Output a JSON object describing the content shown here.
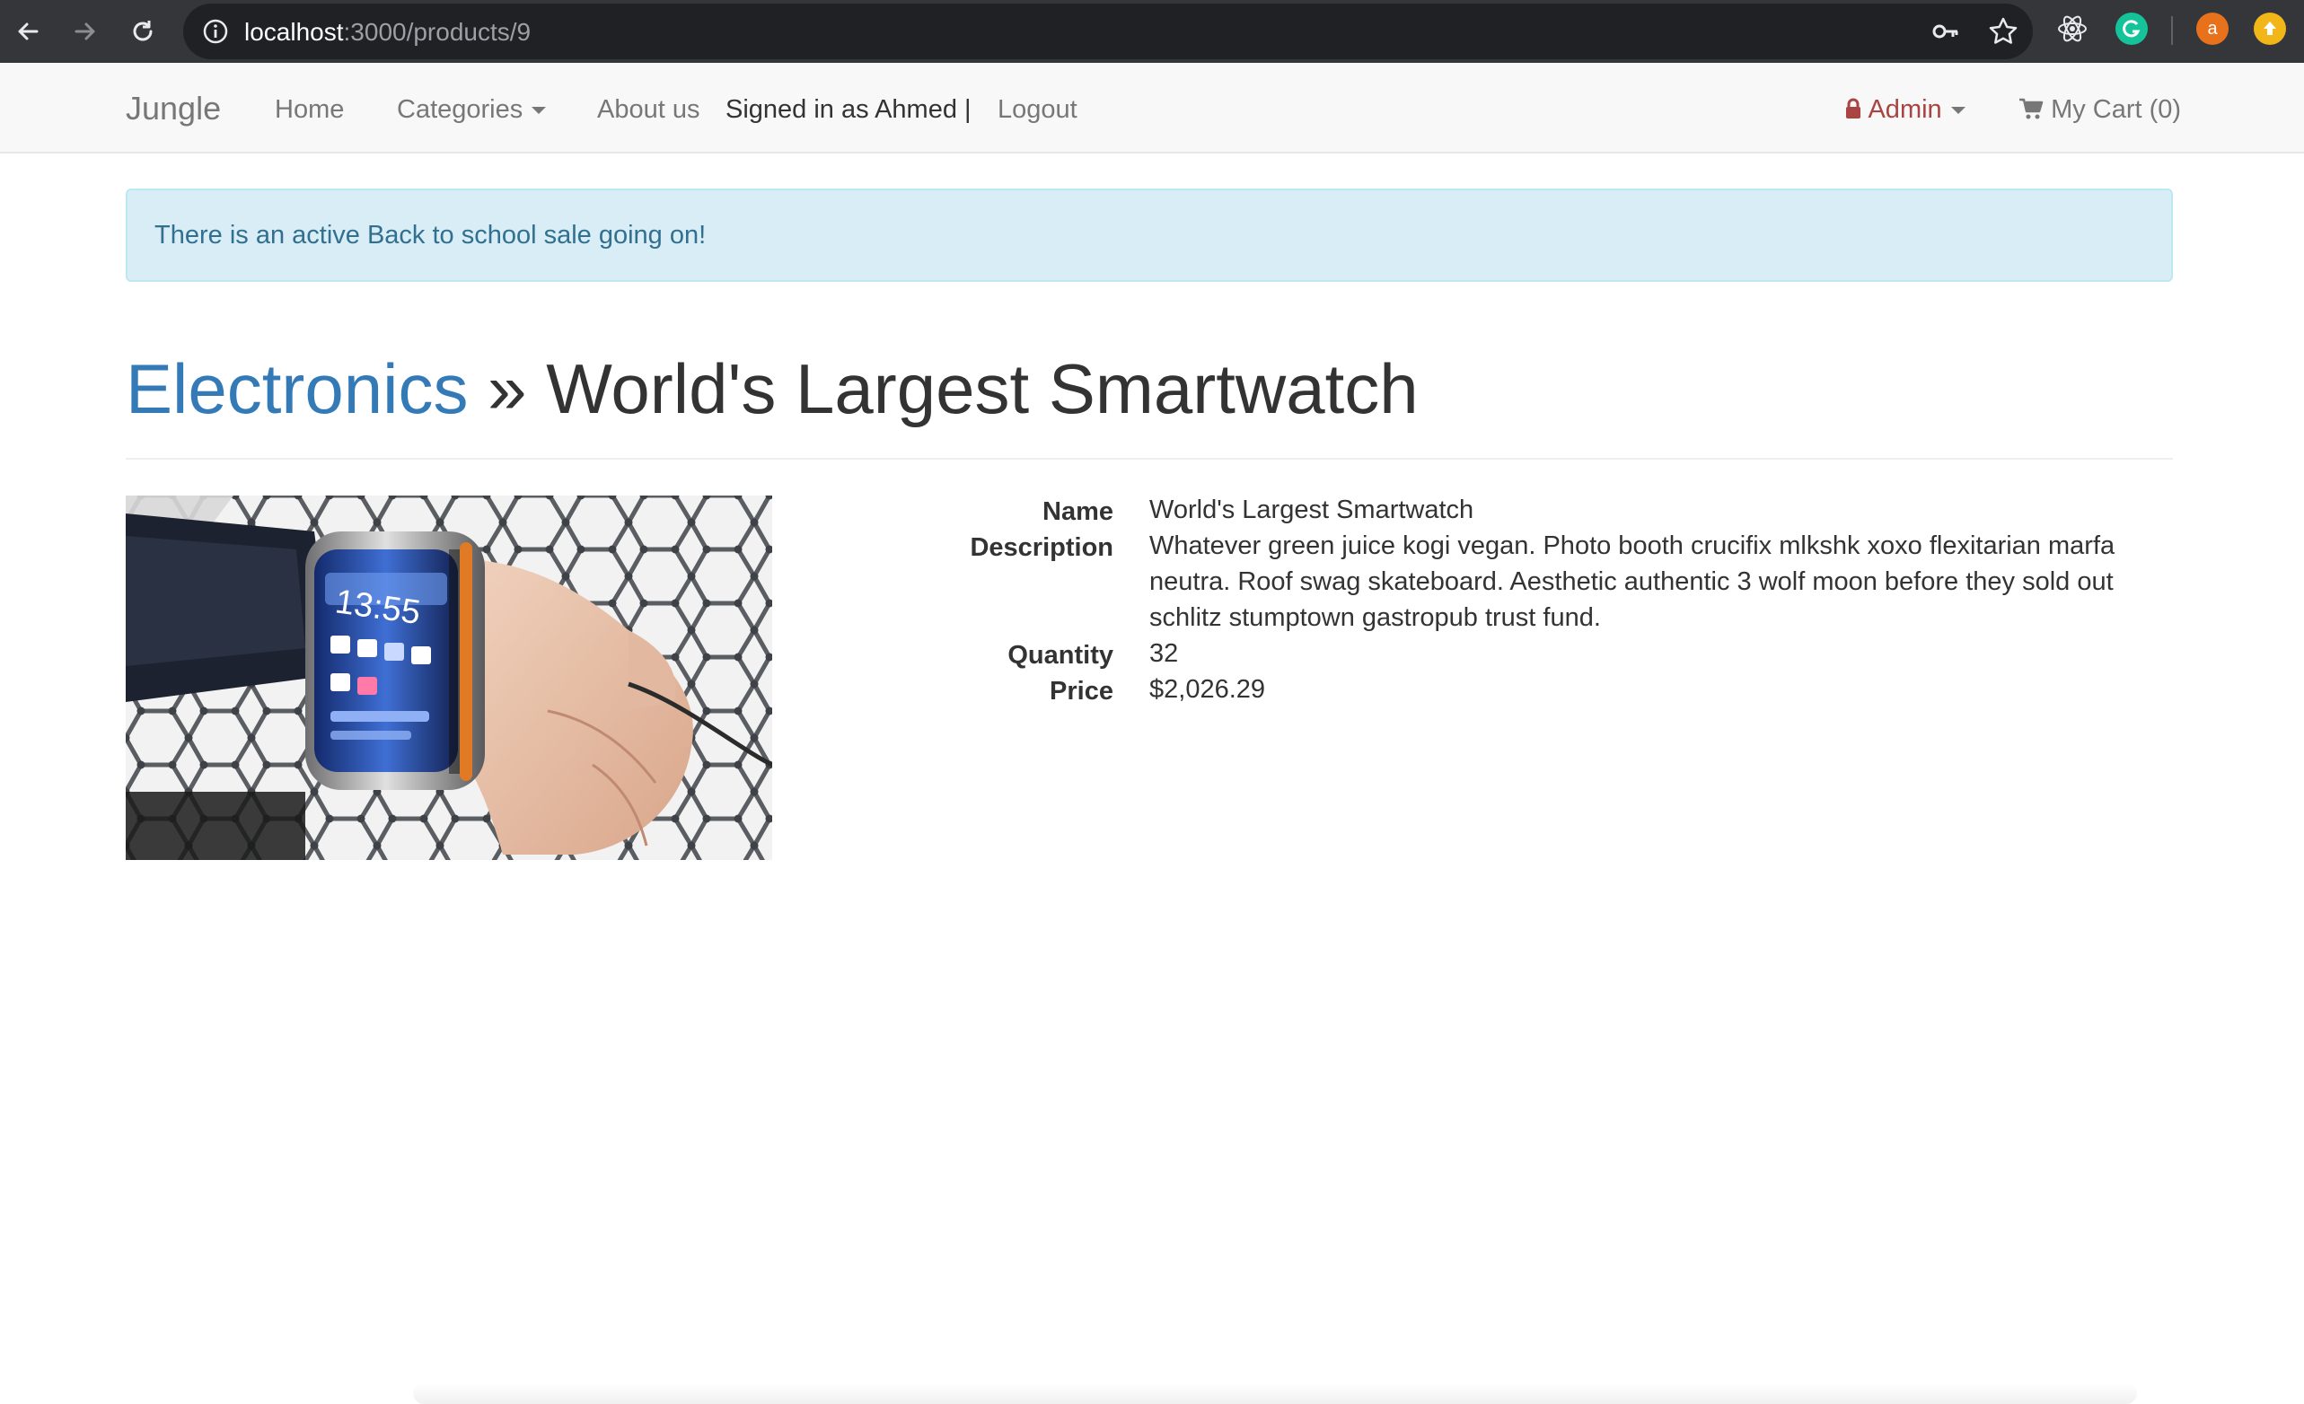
{
  "browser": {
    "url_host": "localhost",
    "url_path": ":3000/products/9",
    "profile_initial": "a",
    "icons": [
      "back-arrow-icon",
      "forward-arrow-icon",
      "reload-icon",
      "info-icon",
      "key-icon",
      "star-icon",
      "react-devtools-icon",
      "grammarly-icon",
      "profile-avatar",
      "extension-icon"
    ]
  },
  "navbar": {
    "brand": "Jungle",
    "home": "Home",
    "categories": "Categories",
    "about": "About us",
    "signed_in": "Signed in as Ahmed |",
    "logout": "Logout",
    "admin": "Admin",
    "cart": "My Cart (0)",
    "admin_color": "#a94442"
  },
  "alert": {
    "text": "There is an active Back to school sale going on!"
  },
  "heading": {
    "category": "Electronics",
    "separator": " » ",
    "product": "World's Largest Smartwatch"
  },
  "product": {
    "labels": {
      "name": "Name",
      "description": "Description",
      "quantity": "Quantity",
      "price": "Price"
    },
    "name": "World's Largest Smartwatch",
    "description": "Whatever green juice kogi vegan. Photo booth crucifix mlkshk xoxo flexitarian marfa neutra. Roof swag skateboard. Aesthetic authentic 3 wolf moon before they sold out schlitz stumptown gastropub trust fund.",
    "quantity": "32",
    "price": "$2,026.29",
    "image_watch_time": "13:55"
  },
  "colors": {
    "link": "#337ab7",
    "alert_bg": "#d9edf7",
    "alert_text": "#31708f"
  }
}
